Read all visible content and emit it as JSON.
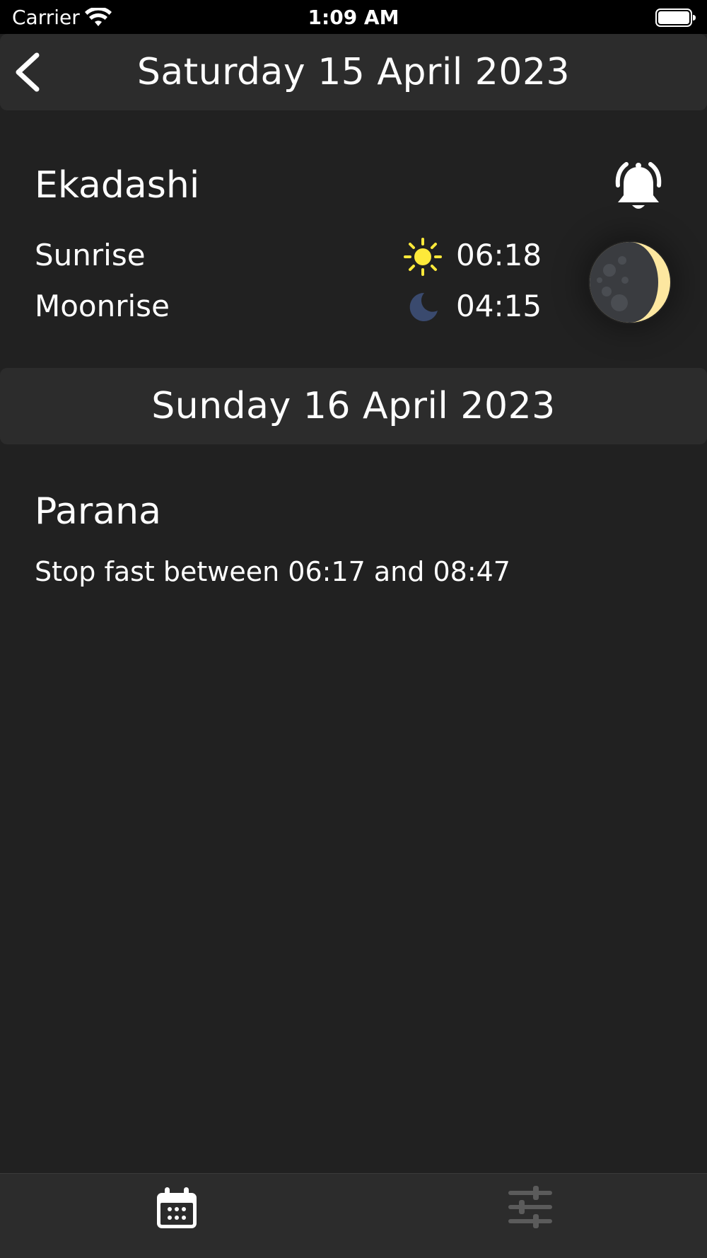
{
  "status_bar": {
    "carrier": "Carrier",
    "time": "1:09 AM"
  },
  "day1": {
    "date_title": "Saturday 15 April 2023",
    "event_title": "Ekadashi",
    "sunrise_label": "Sunrise",
    "sunrise_time": "06:18",
    "moonrise_label": "Moonrise",
    "moonrise_time": "04:15",
    "icons": {
      "back": "chevron-left-icon",
      "alarm": "bell-icon",
      "sun": "sun-icon",
      "moon": "crescent-moon-icon",
      "phase": "moon-phase-icon"
    }
  },
  "day2": {
    "date_title": "Sunday 16 April 2023",
    "event_title": "Parana",
    "description": "Stop fast between 06:17 and 08:47"
  },
  "tab_bar": {
    "items": [
      {
        "icon": "calendar-icon",
        "active": true
      },
      {
        "icon": "sliders-icon",
        "active": false
      }
    ]
  },
  "colors": {
    "background": "#212121",
    "header": "#2c2c2c",
    "text": "#ffffff",
    "sun": "#fde93a",
    "moonrise": "#3a4a6e",
    "moon_lit": "#fde7a0",
    "moon_dark": "#3a3c40",
    "tab_active": "#ffffff",
    "tab_inactive": "#5b5b5b"
  }
}
